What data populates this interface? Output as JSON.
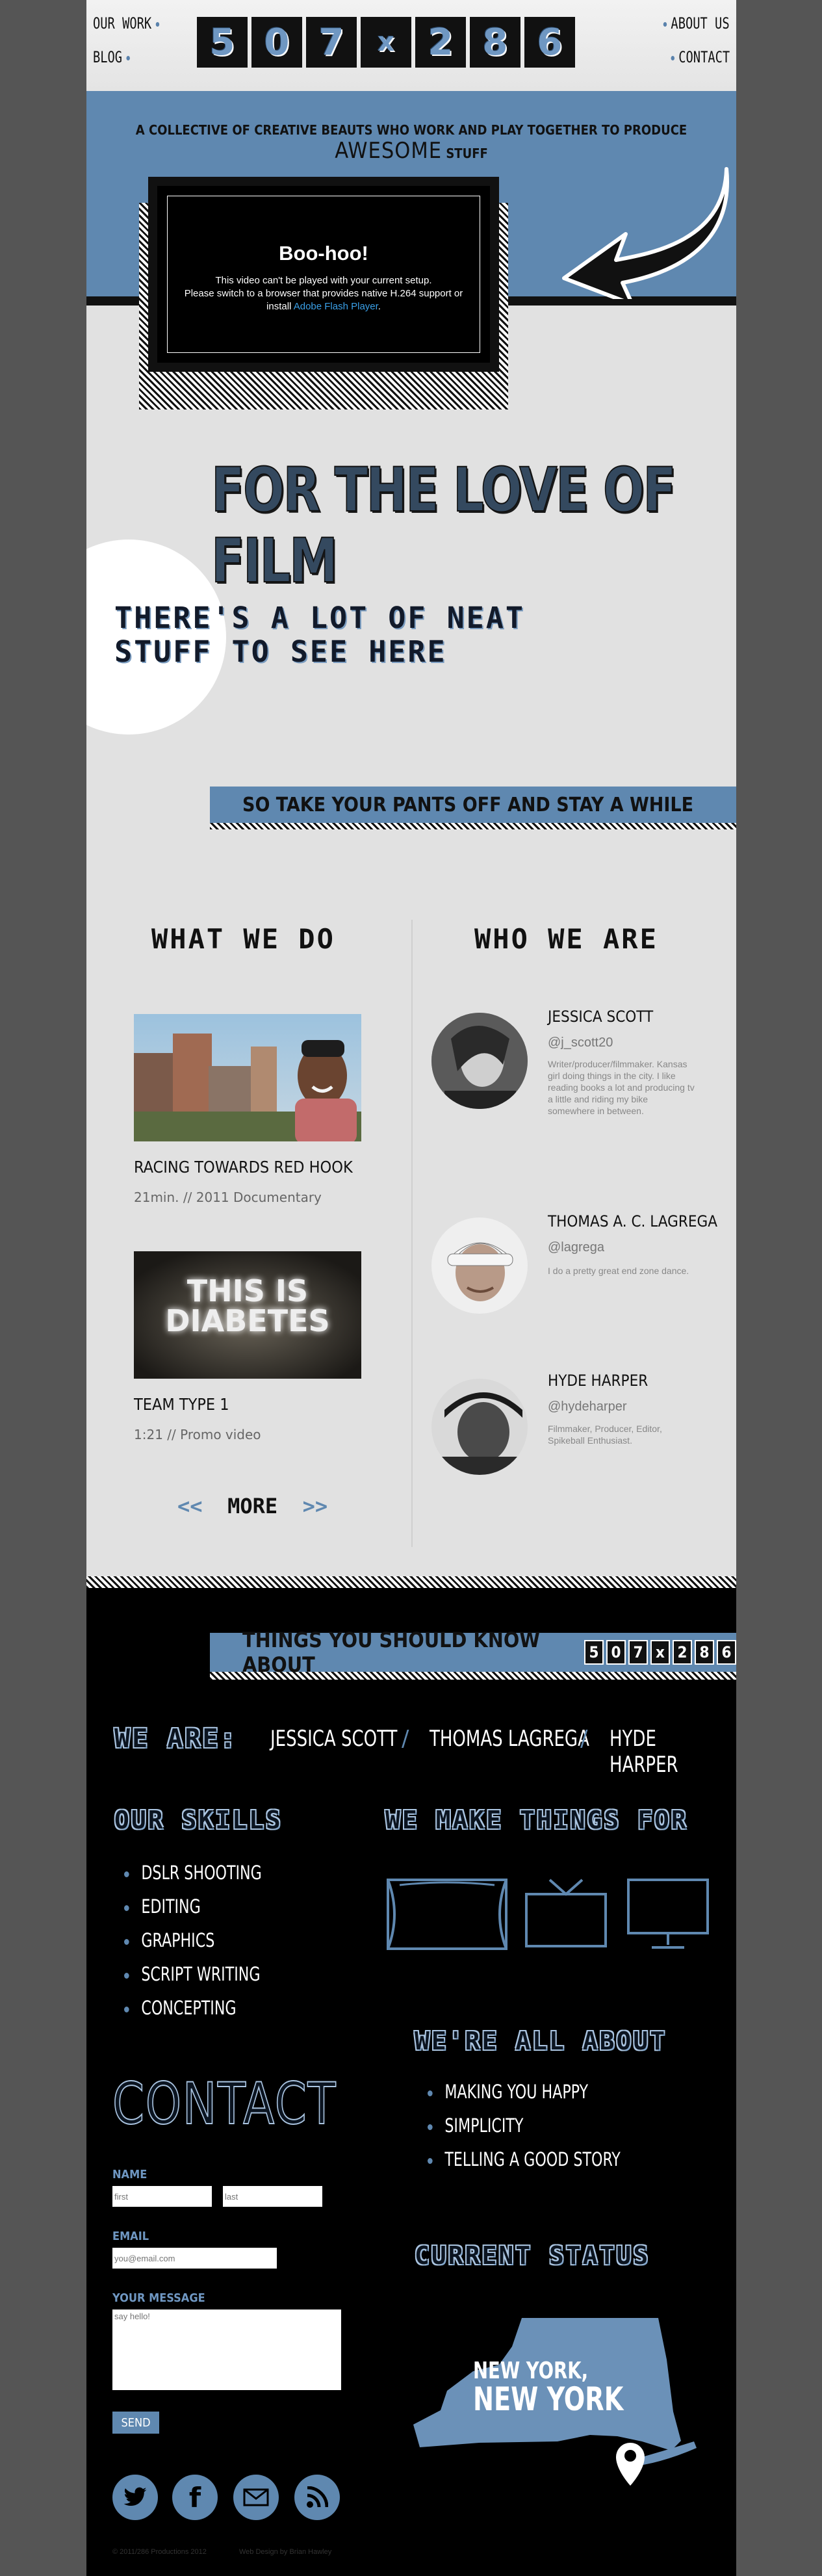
{
  "header": {
    "nav_left": [
      "OUR WORK",
      "BLOG"
    ],
    "nav_right": [
      "ABOUT US",
      "CONTACT"
    ],
    "logo_tiles": [
      "5",
      "0",
      "7",
      "x",
      "2",
      "8",
      "6"
    ]
  },
  "hero": {
    "tagline_pre": "A COLLECTIVE OF CREATIVE BEAUTS WHO WORK AND PLAY TOGETHER TO PRODUCE",
    "tagline_big": "AWESOME",
    "tagline_post": "STUFF",
    "video": {
      "title": "Boo-hoo!",
      "line1": "This video can't be played with your current setup.",
      "line2": "Please switch to a browser that provides native H.264 support or",
      "line3_pre": "install",
      "link": "Adobe Flash Player",
      "line3_post": "."
    }
  },
  "intro": {
    "title": "FOR THE LOVE OF FILM",
    "neat_line1": "THERE'S A LOT OF NEAT",
    "neat_line2": "STUFF TO SEE HERE",
    "pants": "SO TAKE YOUR PANTS OFF AND STAY A WHILE"
  },
  "what_we_do": {
    "heading": "WHAT WE DO",
    "items": [
      {
        "title": "RACING TOWARDS RED HOOK",
        "meta": "21min. // 2011 Documentary",
        "thumb_text": ""
      },
      {
        "title": "TEAM TYPE 1",
        "meta": "1:21 // Promo video",
        "thumb_text": "THIS IS DIABETES"
      }
    ],
    "more": "MORE",
    "more_left": "<<",
    "more_right": ">>"
  },
  "who_we_are": {
    "heading": "WHO WE ARE",
    "people": [
      {
        "name": "JESSICA SCOTT",
        "handle": "@j_scott20",
        "bio": "Writer/producer/filmmaker. Kansas girl doing things in the city. I like reading books a lot and producing tv a little and riding my bike somewhere in between."
      },
      {
        "name": "THOMAS A. C. LAGREGA",
        "handle": "@lagrega",
        "bio": "I do a pretty great end zone dance."
      },
      {
        "name": "HYDE HARPER",
        "handle": "@hydeharper",
        "bio": "Filmmaker, Producer, Editor, Spikeball Enthusiast."
      }
    ]
  },
  "things": {
    "bar": "THINGS YOU SHOULD KNOW ABOUT",
    "mini_tiles": [
      "5",
      "0",
      "7",
      "x",
      "2",
      "8",
      "6"
    ],
    "we_are_label": "WE ARE:",
    "we_are": [
      "JESSICA SCOTT",
      "THOMAS LAGREGA",
      "HYDE HARPER"
    ],
    "skills_heading": "OUR SKILLS",
    "skills": [
      "DSLR SHOOTING",
      "EDITING",
      "GRAPHICS",
      "SCRIPT WRITING",
      "CONCEPTING"
    ],
    "make_heading": "WE MAKE THINGS FOR",
    "make_icons": [
      "film-screen-icon",
      "television-icon",
      "computer-monitor-icon"
    ],
    "about_heading": "WE'RE ALL ABOUT",
    "about": [
      "MAKING YOU HAPPY",
      "SIMPLICITY",
      "TELLING A GOOD STORY"
    ],
    "status_heading": "CURRENT STATUS",
    "status_line1": "NEW YORK,",
    "status_line2": "NEW YORK"
  },
  "contact": {
    "title": "CONTACT",
    "name_label": "NAME",
    "first_placeholder": "first",
    "last_placeholder": "last",
    "email_label": "EMAIL",
    "email_placeholder": "you@email.com",
    "message_label": "YOUR MESSAGE",
    "message_placeholder": "say hello!",
    "send": "SEND",
    "social": [
      "twitter-icon",
      "facebook-icon",
      "email-icon",
      "rss-icon"
    ]
  },
  "footer": {
    "left": "© 2011/286 Productions 2012",
    "right": "Web Design by Brian Hawley"
  },
  "colors": {
    "accent": "#5f88b0",
    "background": "#e1e1e1",
    "dark": "#000000",
    "outer": "#555555"
  }
}
